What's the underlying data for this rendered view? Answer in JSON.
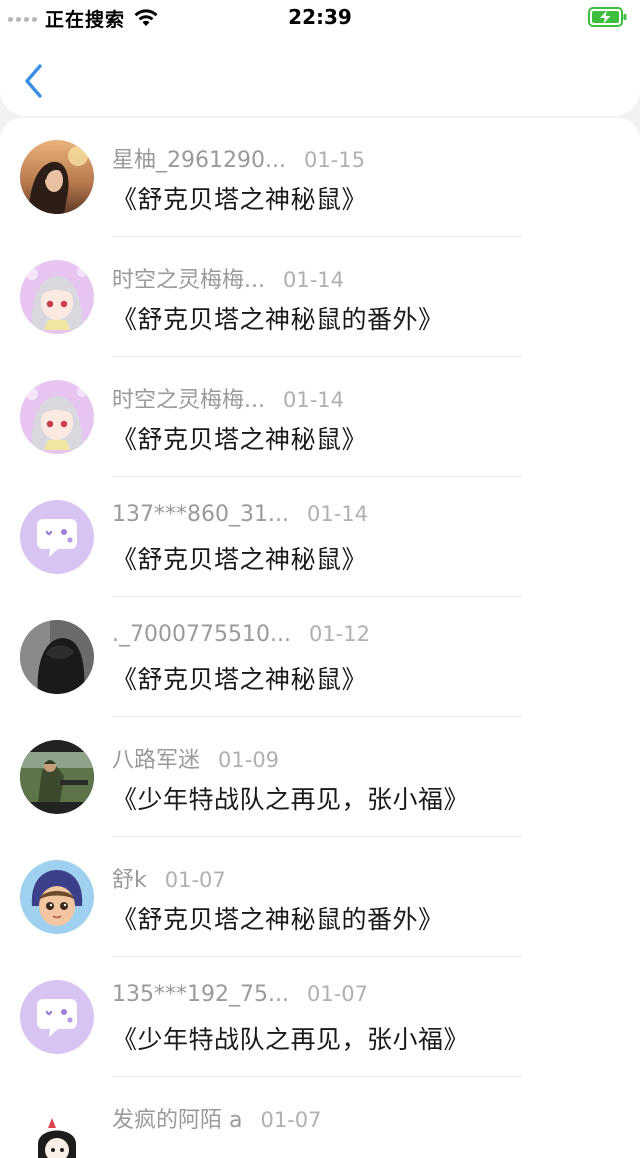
{
  "status_bar": {
    "carrier": "正在搜索",
    "time": "22:39",
    "signal_icon": "signal-dots-icon",
    "wifi_icon": "wifi-icon",
    "battery_icon": "battery-charging-icon",
    "battery_color": "#3dbf3d"
  },
  "nav": {
    "back_icon": "chevron-left-icon",
    "accent": "#3a8ee6"
  },
  "items": [
    {
      "name": "星柚_2961290...",
      "date": "01-15",
      "title": "《舒克贝塔之神秘鼠》",
      "avatar": "photo-sunset-girl"
    },
    {
      "name": "时空之灵梅梅...",
      "date": "01-14",
      "title": "《舒克贝塔之神秘鼠的番外》",
      "avatar": "anime-girl-lavender"
    },
    {
      "name": "时空之灵梅梅...",
      "date": "01-14",
      "title": "《舒克贝塔之神秘鼠》",
      "avatar": "anime-girl-lavender"
    },
    {
      "name": "137***860_31...",
      "date": "01-14",
      "title": "《舒克贝塔之神秘鼠》",
      "avatar": "default-chat-bubble"
    },
    {
      "name": "._7000775510...",
      "date": "01-12",
      "title": "《舒克贝塔之神秘鼠》",
      "avatar": "photo-dark-portrait"
    },
    {
      "name": "八路军迷",
      "date": "01-09",
      "title": "《少年特战队之再见，张小福》",
      "avatar": "photo-soldier"
    },
    {
      "name": "舒k",
      "date": "01-07",
      "title": "《舒克贝塔之神秘鼠的番外》",
      "avatar": "cartoon-boy-helmet"
    },
    {
      "name": "135***192_75...",
      "date": "01-07",
      "title": "《少年特战队之再见，张小福》",
      "avatar": "default-chat-bubble"
    },
    {
      "name": "发疯的阿陌 a",
      "date": "01-07",
      "title": "",
      "avatar": "cartoon-doodle"
    }
  ]
}
